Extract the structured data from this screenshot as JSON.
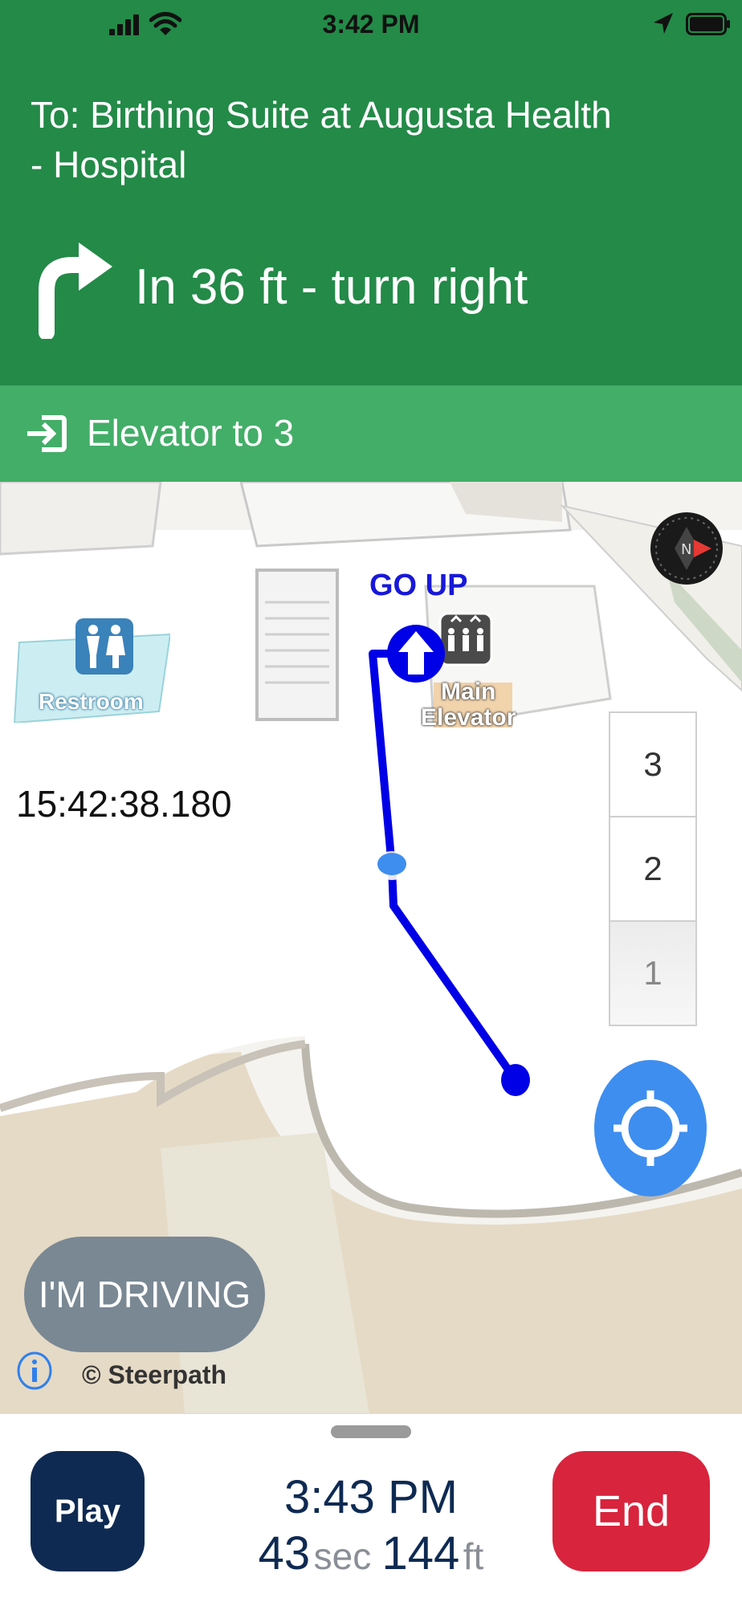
{
  "status_bar": {
    "time": "3:42 PM"
  },
  "header": {
    "destination": "To: Birthing Suite at Augusta Health\n- Hospital",
    "instruction": "In 36 ft - turn right",
    "next_step": "Elevator to 3",
    "color": "#238A48",
    "sub_color": "#43AE68"
  },
  "map": {
    "restroom_label": "Restroom",
    "timestamp": "15:42:38.180",
    "go_up_label": "GO UP",
    "elevator_label_line1": "Main",
    "elevator_label_line2": "Elevator",
    "route_color": "#0000E6",
    "floors": [
      "3",
      "2",
      "1"
    ],
    "active_floor": "1",
    "driving_button": "I'M DRIVING",
    "attribution": "© Steerpath"
  },
  "bottom": {
    "play_label": "Play",
    "eta_time": "3:43 PM",
    "duration_value": "43",
    "duration_unit": "sec",
    "distance_value": "144",
    "distance_unit": "ft",
    "end_label": "End"
  }
}
